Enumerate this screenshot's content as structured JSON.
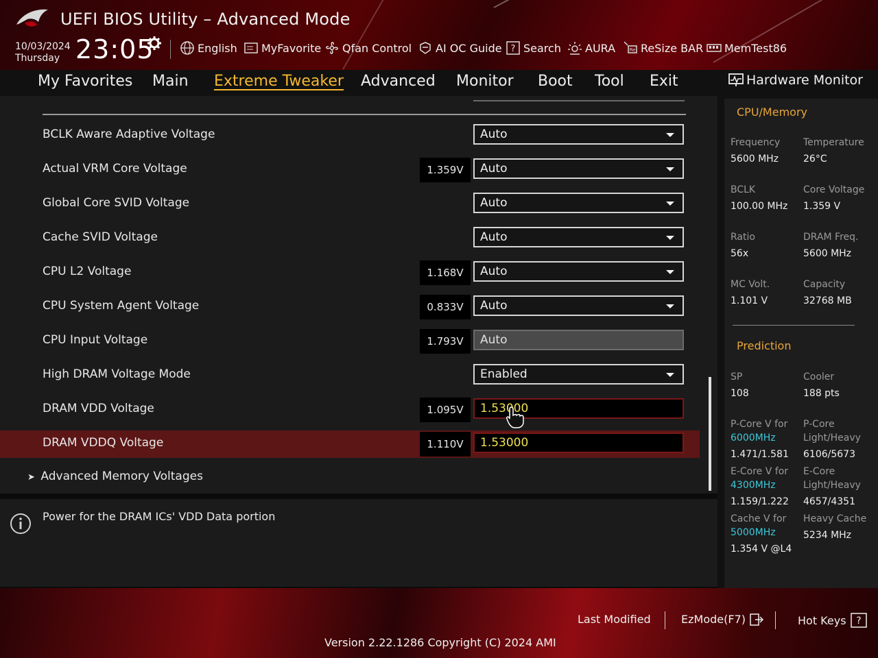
{
  "header": {
    "title": "UEFI BIOS Utility – Advanced Mode",
    "date": "10/03/2024",
    "day": "Thursday",
    "time": "23:05",
    "tools": [
      {
        "label": "English",
        "icon": "globe-icon"
      },
      {
        "label": "MyFavorite",
        "icon": "favorite-icon"
      },
      {
        "label": "Qfan Control",
        "icon": "fan-icon"
      },
      {
        "label": "AI OC Guide",
        "icon": "ai-guide-icon"
      },
      {
        "label": "Search",
        "icon": "search-help-icon"
      },
      {
        "label": "AURA",
        "icon": "aura-icon"
      },
      {
        "label": "ReSize BAR",
        "icon": "resize-bar-icon"
      },
      {
        "label": "MemTest86",
        "icon": "memtest-icon"
      }
    ]
  },
  "tabs": [
    "My Favorites",
    "Main",
    "Extreme Tweaker",
    "Advanced",
    "Monitor",
    "Boot",
    "Tool",
    "Exit"
  ],
  "active_tab": "Extreme Tweaker",
  "settings": [
    {
      "label": "BCLK Aware Adaptive Voltage",
      "reading": "",
      "value": "Auto",
      "kind": "select"
    },
    {
      "label": "Actual VRM Core Voltage",
      "reading": "1.359V",
      "value": "Auto",
      "kind": "select"
    },
    {
      "label": "Global Core SVID Voltage",
      "reading": "",
      "value": "Auto",
      "kind": "select"
    },
    {
      "label": "Cache SVID Voltage",
      "reading": "",
      "value": "Auto",
      "kind": "select"
    },
    {
      "label": "CPU L2 Voltage",
      "reading": "1.168V",
      "value": "Auto",
      "kind": "select"
    },
    {
      "label": "CPU System Agent Voltage",
      "reading": "0.833V",
      "value": "Auto",
      "kind": "select"
    },
    {
      "label": "CPU Input Voltage",
      "reading": "1.793V",
      "value": "Auto",
      "kind": "disabled"
    },
    {
      "label": "High DRAM Voltage Mode",
      "reading": "",
      "value": "Enabled",
      "kind": "select"
    },
    {
      "label": "DRAM VDD Voltage",
      "reading": "1.095V",
      "value": "1.53000",
      "kind": "input"
    },
    {
      "label": "DRAM VDDQ Voltage",
      "reading": "1.110V",
      "value": "1.53000",
      "kind": "input"
    }
  ],
  "submenu": "Advanced Memory Voltages",
  "help_text": "Power for the DRAM ICs' VDD Data portion",
  "hardware_monitor": {
    "title": "Hardware Monitor",
    "cpu_memory_title": "CPU/Memory",
    "cpu_memory": [
      {
        "label": "Frequency",
        "value": "5600 MHz"
      },
      {
        "label": "Temperature",
        "value": "26°C"
      },
      {
        "label": "BCLK",
        "value": "100.00 MHz"
      },
      {
        "label": "Core Voltage",
        "value": "1.359 V"
      },
      {
        "label": "Ratio",
        "value": "56x"
      },
      {
        "label": "DRAM Freq.",
        "value": "5600 MHz"
      },
      {
        "label": "MC Volt.",
        "value": "1.101 V"
      },
      {
        "label": "Capacity",
        "value": "32768 MB"
      }
    ],
    "prediction_title": "Prediction",
    "prediction": {
      "sp_label": "SP",
      "sp_value": "108",
      "cooler_label": "Cooler",
      "cooler_value": "188 pts",
      "pcore_v_label": "P-Core V for",
      "pcore_v_freq": "6000MHz",
      "pcore_v_value": "1.471/1.581",
      "pcore_lh_label1": "P-Core",
      "pcore_lh_label2": "Light/Heavy",
      "pcore_lh_value": "6106/5673",
      "ecore_v_label": "E-Core V for",
      "ecore_v_freq": "4300MHz",
      "ecore_v_value": "1.159/1.222",
      "ecore_lh_label1": "E-Core",
      "ecore_lh_label2": "Light/Heavy",
      "ecore_lh_value": "4657/4351",
      "cache_v_label": "Cache V for",
      "cache_v_freq": "5000MHz",
      "cache_v_value": "1.354 V @L4",
      "heavy_cache_label": "Heavy Cache",
      "heavy_cache_value": "5234 MHz"
    }
  },
  "footer": {
    "last_modified": "Last Modified",
    "ezmode": "EzMode(F7)",
    "hot_keys": "Hot Keys",
    "version": "Version 2.22.1286 Copyright (C) 2024 AMI"
  },
  "colors": {
    "accent": "#f5b82e",
    "selected_row": "#5c1616",
    "input_text": "#f0e050",
    "cyan": "#3cc8d8",
    "section": "#e9a63a"
  }
}
